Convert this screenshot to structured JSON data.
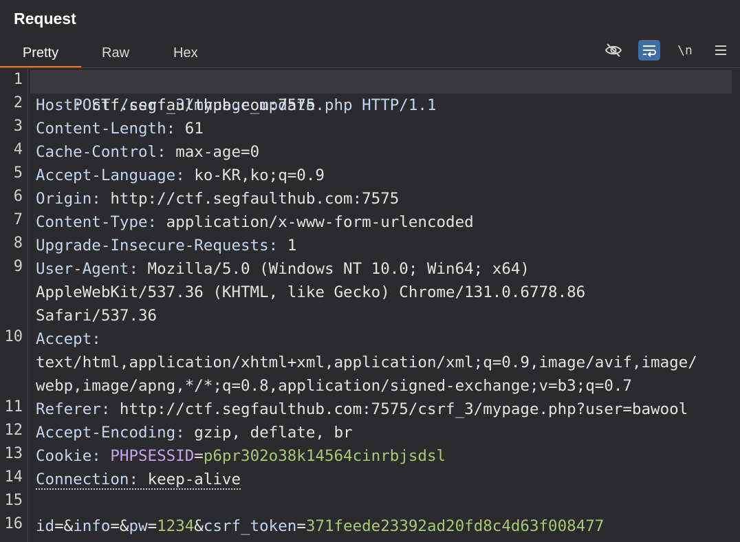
{
  "panel": {
    "title": "Request"
  },
  "tabs": {
    "pretty": "Pretty",
    "raw": "Raw",
    "hex": "Hex"
  },
  "toolbar": {
    "newline_label": "\\n"
  },
  "request": {
    "line_numbers": [
      "1",
      "2",
      "3",
      "4",
      "5",
      "6",
      "7",
      "8",
      "9",
      "10",
      "11",
      "12",
      "13",
      "14",
      "15",
      "16"
    ],
    "request_line": "POST /csrf_3/mypage_update.php HTTP/1.1",
    "headers": {
      "host": {
        "name": "Host:",
        "value": " ctf.segfaulthub.com:7575"
      },
      "content_length": {
        "name": "Content-Length:",
        "value": " 61"
      },
      "cache_control": {
        "name": "Cache-Control:",
        "value": " max-age=0"
      },
      "accept_language": {
        "name": "Accept-Language:",
        "value": " ko-KR,ko;q=0.9"
      },
      "origin": {
        "name": "Origin:",
        "value": " http://ctf.segfaulthub.com:7575"
      },
      "content_type": {
        "name": "Content-Type:",
        "value": " application/x-www-form-urlencoded"
      },
      "upgrade_insecure": {
        "name": "Upgrade-Insecure-Requests:",
        "value": " 1"
      },
      "user_agent": {
        "name": "User-Agent:",
        "value_1": " Mozilla/5.0 (Windows NT 10.0; Win64; x64)",
        "value_2": "AppleWebKit/537.36 (KHTML, like Gecko) Chrome/131.0.6778.86",
        "value_3": "Safari/537.36"
      },
      "accept": {
        "name": "Accept:",
        "value_1": "text/html,application/xhtml+xml,application/xml;q=0.9,image/avif,image/",
        "value_2": "webp,image/apng,*/*;q=0.8,application/signed-exchange;v=b3;q=0.7"
      },
      "referer": {
        "name": "Referer:",
        "value": " http://ctf.segfaulthub.com:7575/csrf_3/mypage.php?user=bawool"
      },
      "accept_encoding": {
        "name": "Accept-Encoding:",
        "value": " gzip, deflate, br"
      },
      "cookie": {
        "name": "Cookie:",
        "key": "PHPSESSID",
        "eq": "=",
        "value": "p6pr302o38k14564cinrbjsdsl"
      },
      "connection": {
        "name": "Connection:",
        "value": "keep-alive"
      }
    },
    "body": {
      "k1": "id",
      "e1": "=&",
      "k2": "info",
      "e2": "=&",
      "k3": "pw",
      "e3": "=",
      "v3": "1234",
      "a3": "&",
      "k4": "csrf_token",
      "e4": "=",
      "v4": "371feede23392ad20fd8c4d63f008477"
    }
  }
}
